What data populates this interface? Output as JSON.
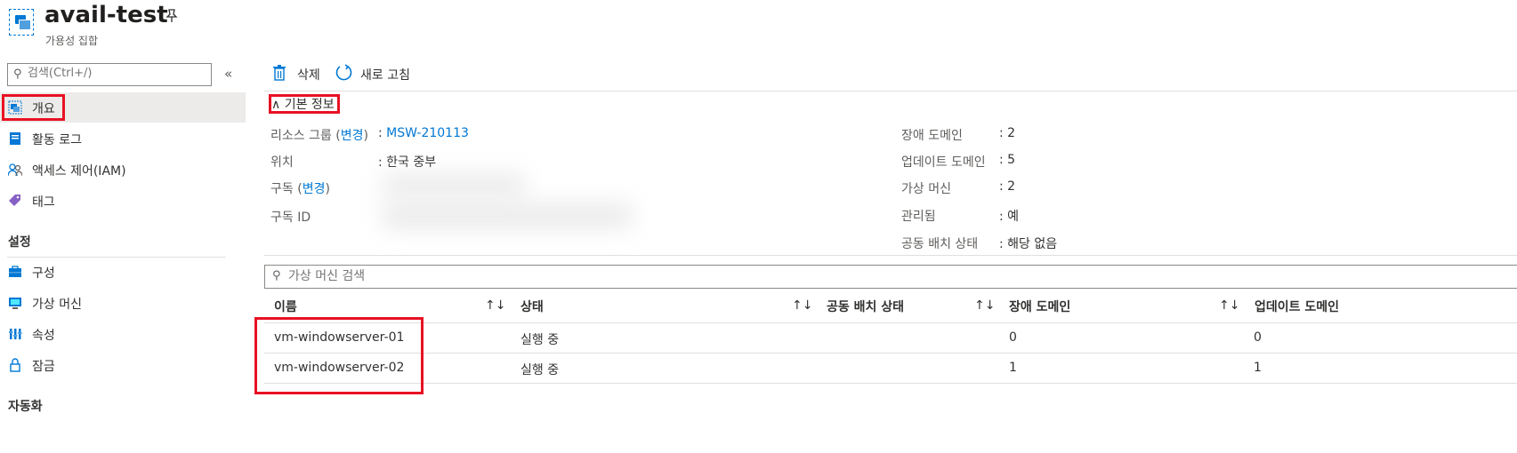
{
  "header": {
    "title": "avail-test",
    "subtitle": "가용성 집합"
  },
  "sidebar": {
    "search_placeholder": "검색(Ctrl+/)",
    "collapse_glyph": "«",
    "items": [
      {
        "label": "개요",
        "icon": "availability-set-icon"
      },
      {
        "label": "활동 로그",
        "icon": "activity-log-icon"
      },
      {
        "label": "액세스 제어(IAM)",
        "icon": "people-icon"
      },
      {
        "label": "태그",
        "icon": "tag-icon"
      }
    ],
    "settings_header": "설정",
    "settings_items": [
      {
        "label": "구성",
        "icon": "toolbox-icon"
      },
      {
        "label": "가상 머신",
        "icon": "monitor-icon"
      },
      {
        "label": "속성",
        "icon": "properties-icon"
      },
      {
        "label": "잠금",
        "icon": "lock-icon"
      }
    ],
    "automation_header": "자동화"
  },
  "toolbar": {
    "delete_label": "삭제",
    "refresh_label": "새로 고침"
  },
  "essentials": {
    "toggle_label": "기본 정보",
    "left": {
      "resource_group_label": "리소스 그룹",
      "change_link": "변경",
      "resource_group_value": "MSW-210113",
      "location_label": "위치",
      "location_value": "한국 중부",
      "subscription_label": "구독",
      "subscription_id_label": "구독 ID"
    },
    "right": [
      {
        "label": "장애 도메인",
        "value": "2"
      },
      {
        "label": "업데이트 도메인",
        "value": "5"
      },
      {
        "label": "가상 머신",
        "value": "2"
      },
      {
        "label": "관리됨",
        "value": "예"
      },
      {
        "label": "공동 배치 상태",
        "value": "해당 없음"
      }
    ]
  },
  "vm_grid": {
    "search_placeholder": "가상 머신 검색",
    "sort_glyph": "↑↓",
    "columns": [
      "이름",
      "상태",
      "공동 배치 상태",
      "장애 도메인",
      "업데이트 도메인"
    ],
    "rows": [
      {
        "name": "vm-windowserver-01",
        "status": "실행 중",
        "ppg": "",
        "fault": "0",
        "update": "0"
      },
      {
        "name": "vm-windowserver-02",
        "status": "실행 중",
        "ppg": "",
        "fault": "1",
        "update": "1"
      }
    ]
  },
  "colors": {
    "accent": "#0078d4",
    "highlight_box": "#e81123",
    "selected_bg": "#edebe9"
  }
}
